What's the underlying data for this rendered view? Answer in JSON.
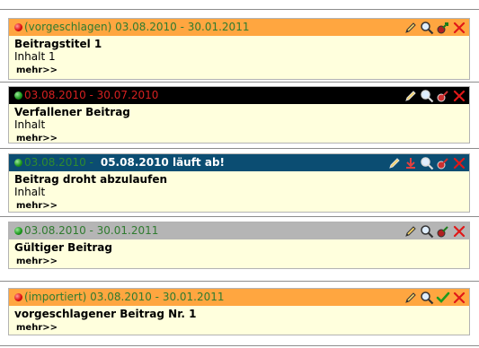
{
  "entries": [
    {
      "status_dot": "red",
      "header_text": "(vorgeschlagen) 03.08.2010 - 30.01.2011",
      "header_text_color": "#2f7b2f",
      "header_bg": "#ffa640",
      "title": "Beitragstitel 1",
      "content": "Inhalt 1",
      "more": "mehr>>",
      "tools": [
        "edit-icon",
        "zoom-icon",
        "publish-icon",
        "delete-icon"
      ]
    },
    {
      "status_dot": "green",
      "header_text": "03.08.2010 - 30.07.2010",
      "header_text_color": "#d42020",
      "header_bg": "#000000",
      "title": "Verfallener Beitrag",
      "content": "Inhalt",
      "more": "mehr>>",
      "tools": [
        "edit-icon",
        "zoom-icon",
        "unpublish-icon",
        "delete-icon"
      ]
    },
    {
      "status_dot": "green",
      "header_text": "03.08.2010 -",
      "header_text_color": "#2f8b2f",
      "header_warning": "05.08.2010 läuft ab!",
      "header_bg": "#0b4d72",
      "title": "Beitrag droht abzulaufen",
      "content": "Inhalt",
      "more": "mehr>>",
      "tools": [
        "edit-icon",
        "download-icon",
        "zoom-icon",
        "unpublish-icon",
        "delete-icon"
      ]
    },
    {
      "status_dot": "green",
      "header_text": "03.08.2010 - 30.01.2011",
      "header_text_color": "#2f7b2f",
      "header_bg": "#b5b5b5",
      "title": "Gültiger Beitrag",
      "content": "",
      "more": "mehr>>",
      "tools": [
        "edit-icon",
        "zoom-icon",
        "unpublish-icon",
        "delete-icon"
      ]
    },
    {
      "status_dot": "red",
      "header_text": "(importiert) 03.08.2010 - 30.01.2011",
      "header_text_color": "#2f7b2f",
      "header_bg": "#ffa640",
      "title": "vorgeschlagener Beitrag Nr. 1",
      "content": "",
      "more": "mehr>>",
      "tools": [
        "edit-icon",
        "zoom-icon",
        "approve-icon",
        "delete-icon"
      ]
    }
  ]
}
